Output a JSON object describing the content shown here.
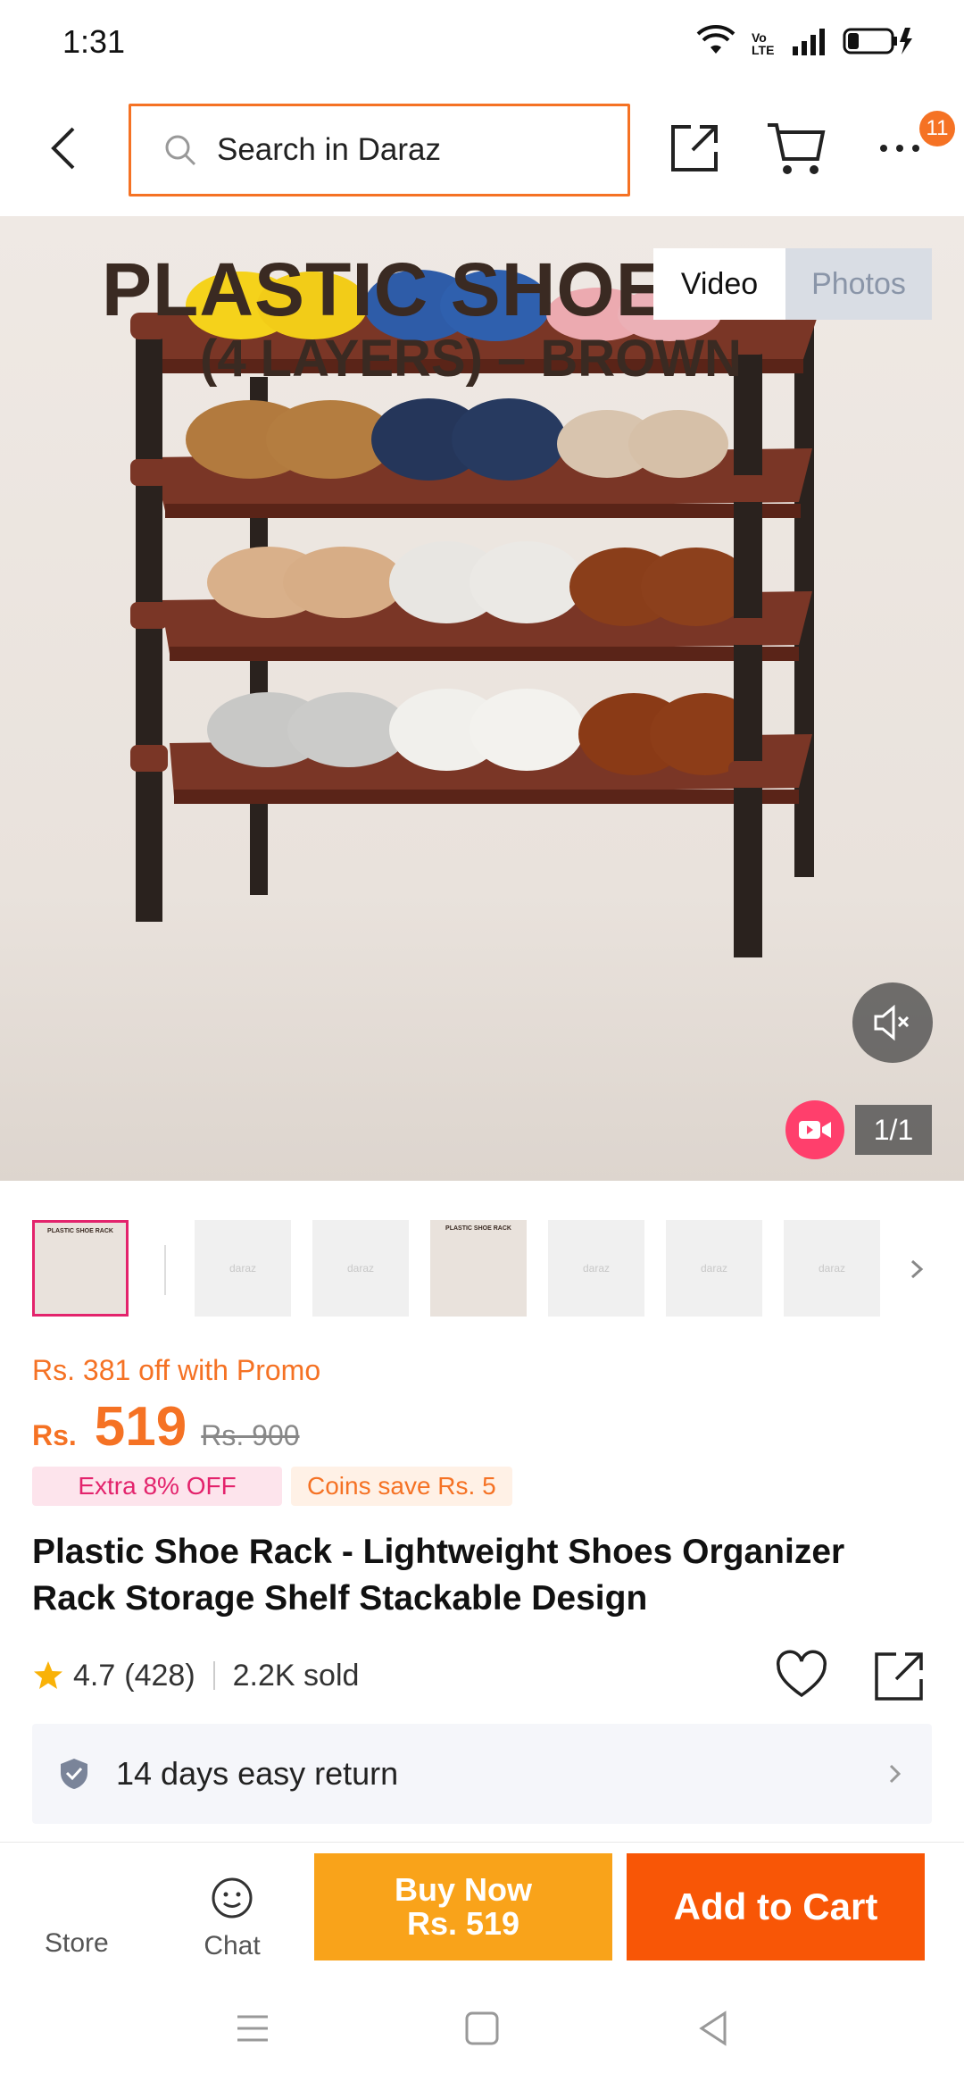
{
  "status_bar": {
    "time": "1:31",
    "network_label": "Vo LTE"
  },
  "nav": {
    "search_placeholder": "Search in Daraz",
    "more_badge": "11"
  },
  "hero": {
    "title_line1": "PLASTIC SHOE",
    "title_line2": "(4 LAYERS) – BROWN",
    "tabs": [
      {
        "label": "Video",
        "active": true
      },
      {
        "label": "Photos",
        "active": false
      }
    ],
    "counter": "1/1"
  },
  "thumbnails": {
    "items": [
      {
        "label": "PLASTIC SHOE RACK",
        "selected": true
      },
      {
        "label": "daraz",
        "selected": false
      },
      {
        "label": "daraz",
        "selected": false
      },
      {
        "label": "PLASTIC SHOE RACK",
        "selected": false
      },
      {
        "label": "daraz",
        "selected": false
      },
      {
        "label": "daraz",
        "selected": false
      },
      {
        "label": "daraz",
        "selected": false
      }
    ]
  },
  "price": {
    "promo_text": "Rs. 381 off with Promo",
    "currency": "Rs.",
    "current": "519",
    "original": "Rs. 900"
  },
  "tags": {
    "extra": "Extra 8% OFF",
    "coins": "Coins save Rs. 5"
  },
  "product": {
    "title": "Plastic Shoe Rack - Lightweight Shoes Organizer Rack Storage Shelf Stackable Design",
    "rating": "4.7",
    "reviews": "(428)",
    "sold": "2.2K sold"
  },
  "return_policy": {
    "text": "14 days easy return"
  },
  "actions": {
    "store_label": "Store",
    "chat_label": "Chat",
    "buy_now_line1": "Buy Now",
    "buy_now_line2": "Rs. 519",
    "add_to_cart": "Add to Cart"
  },
  "colors": {
    "accent": "#f57224",
    "buy_now": "#f9a31a",
    "add_cart": "#f85606",
    "promo_pink": "#e3236c"
  }
}
